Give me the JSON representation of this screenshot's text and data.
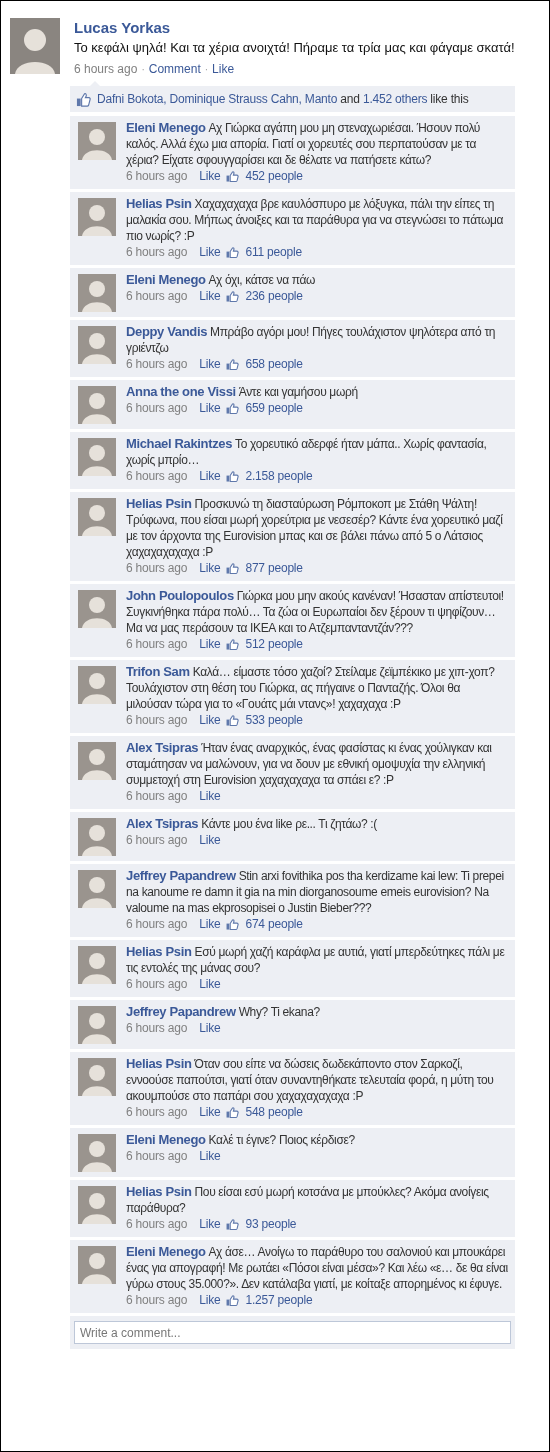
{
  "post": {
    "author": "Lucas Yorkas",
    "text": "Το κεφάλι ψηλά! Και τα χέρια ανοιχτά! Πήραμε τα τρία μας και φάγαμε σκατά!",
    "meta": [
      {
        "kind": "time",
        "text": "6 hours ago"
      },
      {
        "kind": "dot",
        "text": "·"
      },
      {
        "kind": "link",
        "text": "Comment"
      },
      {
        "kind": "dot",
        "text": "·"
      },
      {
        "kind": "link",
        "text": "Like"
      }
    ]
  },
  "likes": {
    "names": "Dafni Bokota, Dominique Strauss Cahn, Manto",
    "joiner": "and",
    "others": "1.452 others",
    "suffix": "like this"
  },
  "comments": [
    {
      "author": "Eleni Menego",
      "text": "Αχ Γιώρκα αγάπη μου μη στεναχωριέσαι. Ήσουν πολύ καλός. Αλλά έχω μια απορία. Γιατί οι χορευτές σου περπατούσαν με τα χέρια? Είχατε σφουγγαρίσει και δε θέλατε να πατήσετε κάτω?",
      "time": "6 hours ago",
      "like": "Like",
      "people": "452 people"
    },
    {
      "author": "Helias Psin",
      "text": "Χαχαχαχαχα βρε καυλόσπυρο με λόξυγκα, πάλι την είπες τη μαλακία σου. Μήπως άνοιξες και τα παράθυρα για να στεγνώσει το πάτωμα πιο νωρίς? :P",
      "time": "6 hours ago",
      "like": "Like",
      "people": "611 people"
    },
    {
      "author": "Eleni Menego",
      "text": "Αχ όχι, κάτσε να πάω",
      "time": "6 hours ago",
      "like": "Like",
      "people": "236 people"
    },
    {
      "author": "Deppy Vandis",
      "text": "Μπράβο αγόρι μου! Πήγες τουλάχιστον ψηλότερα από τη γριέντζω",
      "time": "6 hours ago",
      "like": "Like",
      "people": "658 people"
    },
    {
      "author": "Anna the one Vissi",
      "text": "Άντε και γαμήσου μωρή",
      "time": "6 hours ago",
      "like": "Like",
      "people": "659 people"
    },
    {
      "author": "Michael Rakintzes",
      "text": "Το χορευτικό αδερφέ ήταν μάπα.. Χωρίς φαντασία, χωρίς μπρίο…",
      "time": "6 hours ago",
      "like": "Like",
      "people": "2.158 people"
    },
    {
      "author": "Helias Psin",
      "text": "Προσκυνώ τη διασταύρωση Ρόμποκοπ με Στάθη Ψάλτη! Τρύφωνα, που είσαι μωρή χορεύτρια με νεσεσέρ? Κάντε ένα χορευτικό μαζί με τον άρχοντα της Eurovision μπας και σε βάλει πάνω από 5 ο Λάτσιος χαχαχαχαχαχα :P",
      "time": "6 hours ago",
      "like": "Like",
      "people": "877 people"
    },
    {
      "author": "John Poulopoulos",
      "text": "Γιώρκα μου μην ακούς κανέναν! Ήσασταν απίστευτοι! Συγκινήθηκα πάρα πολύ… Τα ζώα οι Ευρωπαίοι δεν ξέρουν τι ψηφίζουν… Μα να μας περάσουν τα ΙΚΕΑ και το Ατζεμπανταντζάν???",
      "time": "6 hours ago",
      "like": "Like",
      "people": "512 people"
    },
    {
      "author": "Trifon Sam",
      "text": "Καλά… είμαστε τόσο χαζοί? Στείλαμε ζεϊμπέκικο με χιπ-χοπ? Τουλάχιστον στη θέση του Γιώρκα, ας πήγαινε ο Πανταζής. Όλοι θα μιλούσαν τώρα για το «Γουάτς μάι ντανς»! χαχαχαχα :P",
      "time": "6 hours ago",
      "like": "Like",
      "people": "533 people"
    },
    {
      "author": "Alex Tsipras",
      "text": "Ήταν ένας αναρχικός, ένας φασίστας κι ένας χούλιγκαν και σταμάτησαν να μαλώνουν, για να δουν με εθνική ομοψυχία την ελληνική συμμετοχή στη Eurovision χαχαχαχαχα τα σπάει ε? :P",
      "time": "6 hours ago",
      "like": "Like"
    },
    {
      "author": "Alex Tsipras",
      "text": "Κάντε μου ένα like ρε... Τι ζητάω? :(",
      "time": "6 hours ago",
      "like": "Like"
    },
    {
      "author": "Jeffrey Papandrew",
      "text": "Stin arxi fovithika pos tha kerdizame kai lew: Ti prepei na kanoume re damn it gia na min diorganosoume emeis eurovision? Na valoume na mas ekprosopisei o Justin Bieber???",
      "time": "6 hours ago",
      "like": "Like",
      "people": "674 people"
    },
    {
      "author": "Helias Psin",
      "text": "Εσύ μωρή χαζή καράφλα με αυτιά, γιατί μπερδεύτηκες πάλι με τις εντολές της μάνας σου?",
      "time": "6 hours ago",
      "like": "Like"
    },
    {
      "author": "Jeffrey Papandrew",
      "text": "Why? Ti ekana?",
      "time": "6 hours ago",
      "like": "Like"
    },
    {
      "author": "Helias Psin",
      "text": "Όταν σου είπε να δώσεις δωδεκάποντο στον Σαρκοζί, εννοούσε παπούτσι, γιατί όταν συναντηθήκατε τελευταία φορά, η μύτη του ακουμπούσε στο παπάρι σου χαχαχαχαχαχα :P",
      "time": "6 hours ago",
      "like": "Like",
      "people": "548 people"
    },
    {
      "author": "Eleni Menego",
      "text": "Καλέ τι έγινε? Ποιος κέρδισε?",
      "time": "6 hours ago",
      "like": "Like"
    },
    {
      "author": "Helias Psin",
      "text": "Που είσαι εσύ μωρή κοτσάνα με μπούκλες? Ακόμα ανοίγεις παράθυρα?",
      "time": "6 hours ago",
      "like": "Like",
      "people": "93 people"
    },
    {
      "author": "Eleni Menego",
      "text": "Αχ άσε… Ανοίγω το παράθυρο του σαλονιού και μπουκάρει ένας για απογραφή! Με ρωτάει «Πόσοι είναι μέσα»? Και λέω «ε… δε θα είναι γύρω στους 35.000?». Δεν κατάλαβα γιατί, με κοίταξε απορημένος κι έφυγε.",
      "time": "6 hours ago",
      "like": "Like",
      "people": "1.257 people"
    }
  ],
  "comment_field": {
    "placeholder": "Write a comment..."
  }
}
